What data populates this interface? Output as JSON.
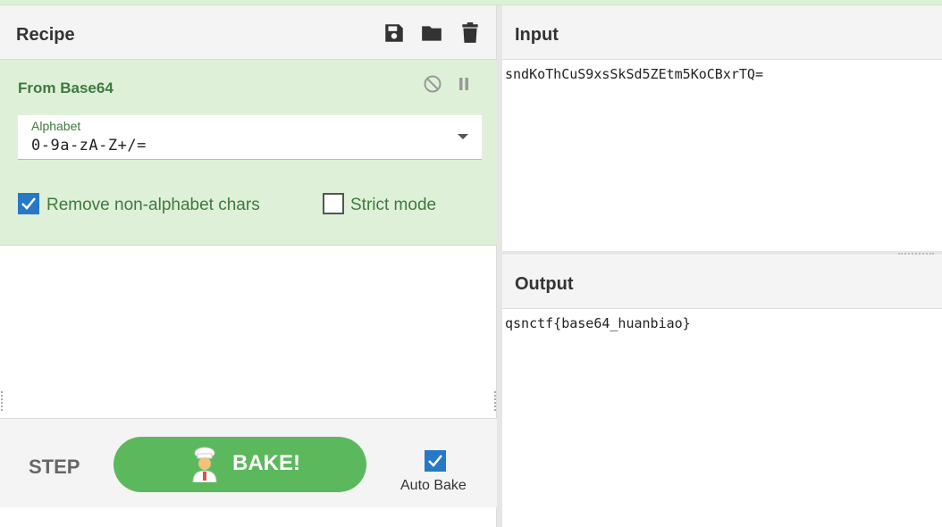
{
  "recipe": {
    "title": "Recipe",
    "icons": [
      "save-icon",
      "folder-icon",
      "trash-icon"
    ]
  },
  "operation": {
    "title": "From Base64",
    "icons": [
      "disable-icon",
      "pause-icon"
    ],
    "alphabet": {
      "label": "Alphabet",
      "value": "0-9a-zA-Z+/="
    },
    "options": [
      {
        "label": "Remove non-alphabet chars",
        "checked": true
      },
      {
        "label": "Strict mode",
        "checked": false
      }
    ]
  },
  "controls": {
    "step_label": "STEP",
    "bake_label": "BAKE!",
    "auto_bake_label": "Auto Bake",
    "auto_bake_checked": true
  },
  "input": {
    "title": "Input",
    "text": "sndKoThCuS9xsSkSd5ZEtm5KoCBxrTQ="
  },
  "output": {
    "title": "Output",
    "text": "qsnctf{base64_huanbiao}"
  },
  "colors": {
    "operation_bg": "#dff0d8",
    "operation_text": "#3d7a3d",
    "bake_button": "#5cb85c",
    "checkbox_checked": "#2878c8"
  }
}
